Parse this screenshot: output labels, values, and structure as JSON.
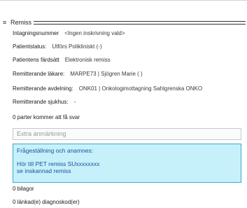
{
  "section": {
    "menu_glyph": "≡",
    "title": "Remiss"
  },
  "fields": [
    {
      "label": "Intagningsnummer",
      "value": "<Ingen inskrivning vald>"
    },
    {
      "label": "Patientstatus:",
      "value": "Utförs Polikliniskt (-)"
    },
    {
      "label": "Patientens färdsätt",
      "value": "Elektronisk remiss"
    },
    {
      "label": "Remitterande läkare:",
      "value": "MARPE73 | Sjögren Marie ( )"
    },
    {
      "label": "Remitterande avdelning:",
      "value": "ONK01 | Onkologimottagning Sahlgrenska ONKO"
    },
    {
      "label": "Remitterande sjukhus:",
      "value": "-"
    }
  ],
  "replies_text": "0 parter kommer att få svar",
  "extra_note": {
    "placeholder": "Extra anmärkning"
  },
  "question_box": {
    "heading": "Frågeställning och anamnes:",
    "lines": [
      "Hör till PET remiss SUxxxxxxxx",
      "se inskannad remiss"
    ]
  },
  "attachments_text": "0 bilagor",
  "diagnosis_text": "0 länkad(e) diagnoskod(er)",
  "colors": {
    "question_box_bg": "#c6f1fb",
    "question_box_border": "#3aa6cf",
    "question_box_text": "#1f4e9c"
  }
}
